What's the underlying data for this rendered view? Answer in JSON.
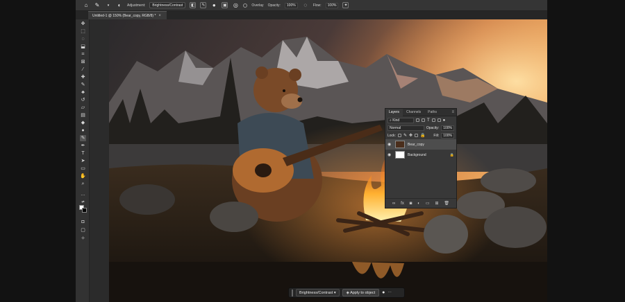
{
  "options_bar": {
    "adjustment_label": "Adjustment:",
    "adjustment_value": "Brightness/Contrast",
    "overlay_label": "Overlay",
    "opacity_label": "Opacity:",
    "opacity_value": "100%",
    "flow_label": "Flow:",
    "flow_value": "100%"
  },
  "document_tab": {
    "title": "Untitled-1 @ 150% (Bear_copy, RGB/8) *",
    "close": "×"
  },
  "layers_panel": {
    "tabs": [
      "Layers",
      "Channels",
      "Paths"
    ],
    "filter_kind": "Kind",
    "blend_mode": "Normal",
    "opacity_label": "Opacity:",
    "opacity_value": "100%",
    "lock_label": "Lock:",
    "fill_label": "Fill:",
    "fill_value": "100%",
    "layers": [
      {
        "name": "Bear_copy",
        "selected": true
      },
      {
        "name": "Background",
        "selected": false
      }
    ]
  },
  "taskbar": {
    "adjustment": "Brightness/Contrast",
    "apply_button": "Apply to object"
  },
  "colors": {
    "ui_dark": "#2b2b2b",
    "panel": "#383838",
    "sunset": "#f0a050"
  }
}
